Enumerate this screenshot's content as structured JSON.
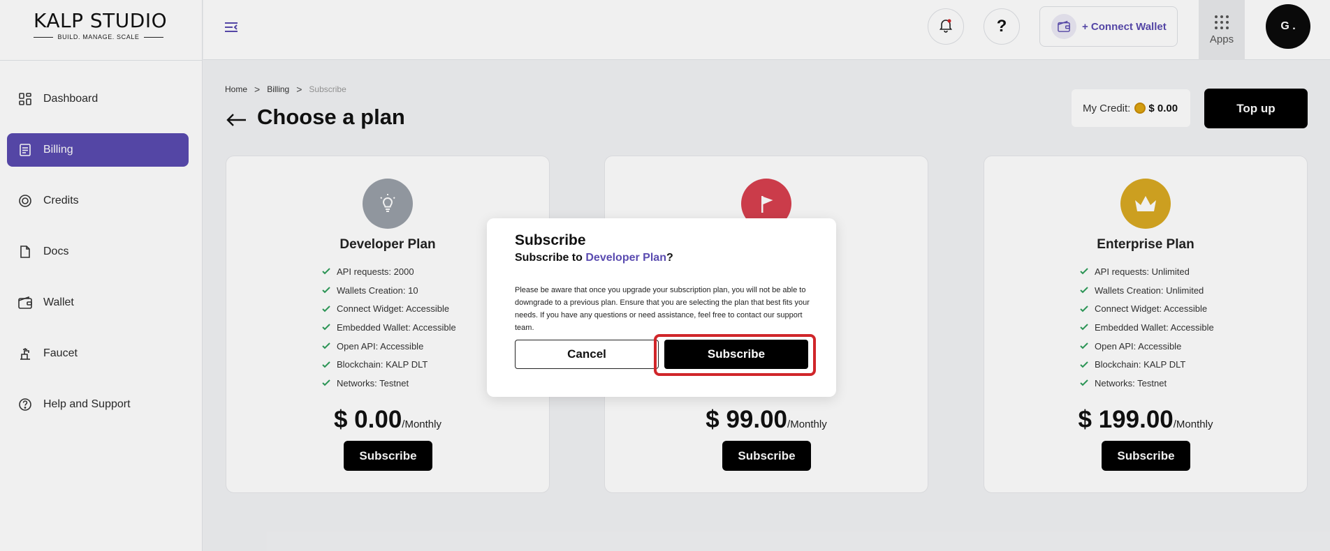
{
  "logo": {
    "brand": "KALP STUDIO",
    "tagline": "BUILD. MANAGE. SCALE"
  },
  "sidebar": {
    "items": [
      {
        "label": "Dashboard",
        "icon": "dashboard-icon"
      },
      {
        "label": "Billing",
        "icon": "billing-icon",
        "active": true
      },
      {
        "label": "Credits",
        "icon": "credits-icon"
      },
      {
        "label": "Docs",
        "icon": "docs-icon"
      },
      {
        "label": "Wallet",
        "icon": "wallet-icon"
      },
      {
        "label": "Faucet",
        "icon": "faucet-icon"
      },
      {
        "label": "Help and Support",
        "icon": "help-icon"
      }
    ]
  },
  "header": {
    "connect_wallet": "+ Connect Wallet",
    "apps_label": "Apps",
    "avatar_initial": "G ."
  },
  "breadcrumb": {
    "home": "Home",
    "billing": "Billing",
    "current": "Subscribe"
  },
  "page_title": "Choose a plan",
  "credit": {
    "label": "My Credit:",
    "amount": "$ 0.00"
  },
  "topup_label": "Top up",
  "plans": [
    {
      "name": "Developer Plan",
      "icon": "lightbulb-icon",
      "icon_color": "#9aa0a8",
      "features": [
        "API requests: 2000",
        "Wallets Creation: 10",
        "Connect Widget: Accessible",
        "Embedded Wallet: Accessible",
        "Open API: Accessible",
        "Blockchain: KALP DLT",
        "Networks: Testnet"
      ],
      "price": "$ 0.00",
      "period": "/Monthly",
      "subscribe_label": "Subscribe"
    },
    {
      "name": "",
      "icon": "flag-icon",
      "icon_color": "#d8404f",
      "features": [],
      "price": "$ 99.00",
      "period": "/Monthly",
      "subscribe_label": "Subscribe"
    },
    {
      "name": "Enterprise Plan",
      "icon": "crown-icon",
      "icon_color": "#d9a922",
      "features": [
        "API requests: Unlimited",
        "Wallets Creation: Unlimited",
        "Connect Widget: Accessible",
        "Embedded Wallet: Accessible",
        "Open API: Accessible",
        "Blockchain: KALP DLT",
        "Networks: Testnet"
      ],
      "price": "$ 199.00",
      "period": "/Monthly",
      "subscribe_label": "Subscribe"
    }
  ],
  "modal": {
    "title": "Subscribe",
    "question_prefix": "Subscribe to ",
    "question_plan": "Developer Plan",
    "question_suffix": "?",
    "body": "Please be aware that once you upgrade your subscription plan, you will not be able to downgrade to a previous plan. Ensure that you are selecting the plan that best fits your needs. If you have any questions or need assistance, feel free to contact our support team.",
    "cancel_label": "Cancel",
    "subscribe_label": "Subscribe"
  },
  "colors": {
    "accent": "#5a4bb0",
    "highlight": "#d0262a",
    "check": "#2e9e5b"
  }
}
